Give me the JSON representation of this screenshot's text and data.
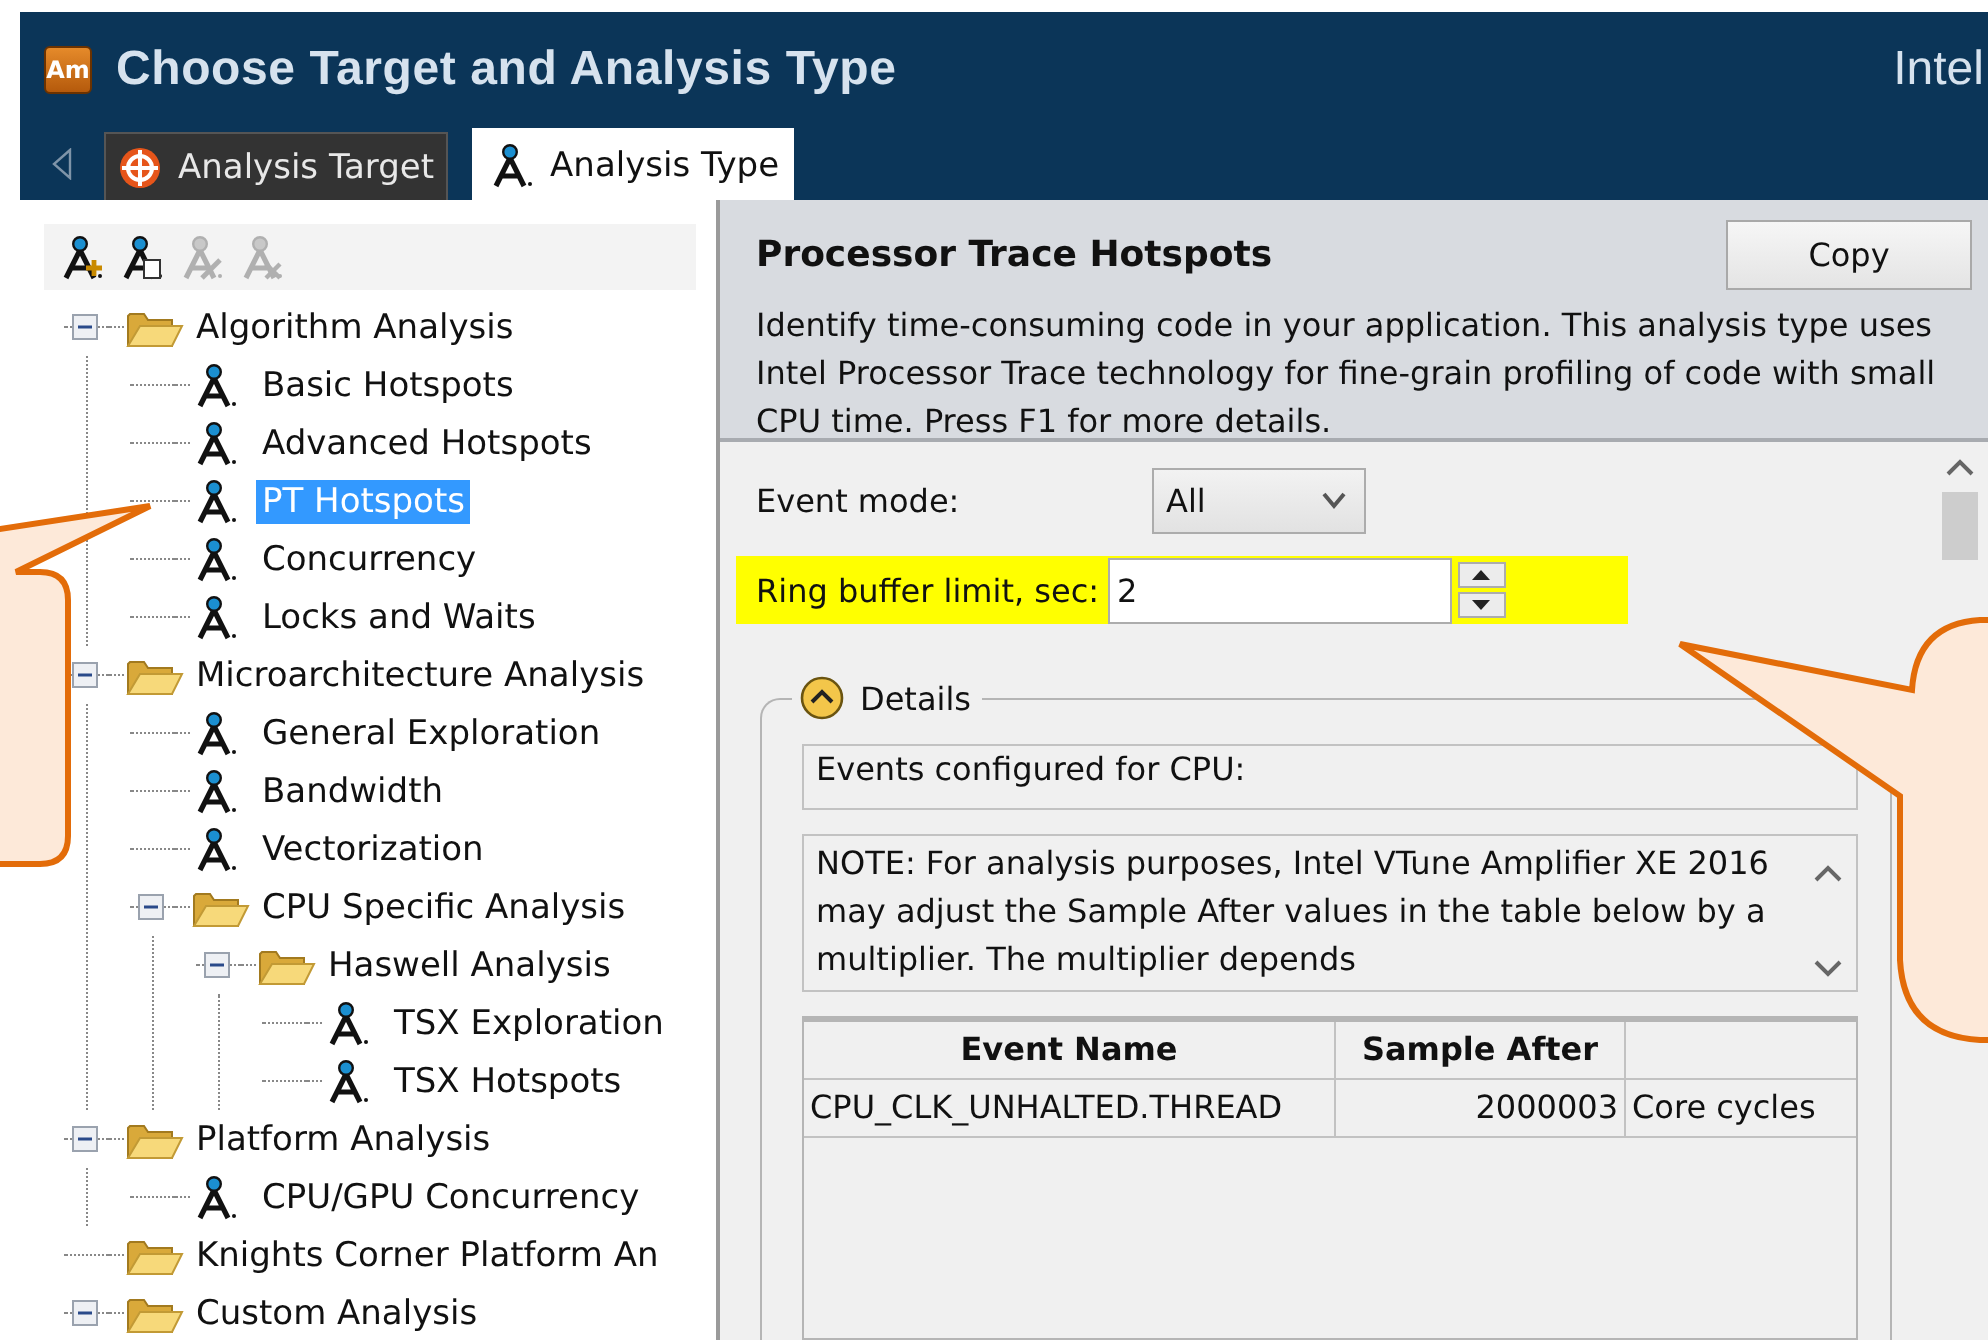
{
  "window": {
    "logo_text": "Am",
    "title": "Choose Target and Analysis Type",
    "brand": "Intel"
  },
  "tabs": [
    {
      "label": "Analysis Target",
      "kind": "target",
      "selected": false
    },
    {
      "label": "Analysis Type",
      "kind": "analysis",
      "selected": true
    }
  ],
  "toolbar": [
    {
      "kind": "add",
      "disabled": false
    },
    {
      "kind": "copy",
      "disabled": false
    },
    {
      "kind": "edit",
      "disabled": true
    },
    {
      "kind": "delete",
      "disabled": true
    }
  ],
  "tree": [
    {
      "label": "Algorithm Analysis",
      "kind": "folder",
      "expanded": true,
      "selected": false,
      "children": [
        {
          "label": "Basic Hotspots",
          "kind": "analysis",
          "selected": false
        },
        {
          "label": "Advanced Hotspots",
          "kind": "analysis",
          "selected": false
        },
        {
          "label": "PT Hotspots",
          "kind": "analysis",
          "selected": true
        },
        {
          "label": "Concurrency",
          "kind": "analysis",
          "selected": false
        },
        {
          "label": "Locks and Waits",
          "kind": "analysis",
          "selected": false
        }
      ]
    },
    {
      "label": "Microarchitecture Analysis",
      "kind": "folder",
      "expanded": true,
      "selected": false,
      "children": [
        {
          "label": "General Exploration",
          "kind": "analysis",
          "selected": false
        },
        {
          "label": "Bandwidth",
          "kind": "analysis",
          "selected": false
        },
        {
          "label": "Vectorization",
          "kind": "analysis",
          "selected": false
        },
        {
          "label": "CPU Specific Analysis",
          "kind": "folder",
          "expanded": true,
          "selected": false,
          "children": [
            {
              "label": "Haswell Analysis",
              "kind": "folder",
              "expanded": true,
              "selected": false,
              "children": [
                {
                  "label": "TSX Exploration",
                  "kind": "analysis",
                  "selected": false
                },
                {
                  "label": "TSX Hotspots",
                  "kind": "analysis",
                  "selected": false
                }
              ]
            }
          ]
        }
      ]
    },
    {
      "label": "Platform Analysis",
      "kind": "folder",
      "expanded": true,
      "selected": false,
      "children": [
        {
          "label": "CPU/GPU Concurrency",
          "kind": "analysis",
          "selected": false
        }
      ]
    },
    {
      "label": "Knights Corner Platform An",
      "kind": "folder",
      "selected": false
    },
    {
      "label": "Custom Analysis",
      "kind": "folder",
      "expanded": true,
      "selected": false
    }
  ],
  "analysis": {
    "title": "Processor Trace Hotspots",
    "copy_button": "Copy",
    "description": "Identify time-consuming code in your application. This analysis type uses Intel Processor Trace technology for fine-grain profiling of code with small CPU time. Press F1 for more details."
  },
  "settings": [
    {
      "kind": "select",
      "label": "Event mode:",
      "value": "All",
      "highlighted": false
    },
    {
      "kind": "spin",
      "label": "Ring buffer limit, sec:",
      "value": "2",
      "highlighted": true
    }
  ],
  "details": {
    "label": "Details",
    "expanded": true,
    "events_heading": "Events configured for CPU:",
    "note": "NOTE: For analysis purposes, Intel VTune Amplifier XE 2016 may adjust the Sample After values in the table below by a multiplier. The multiplier depends",
    "table": {
      "columns": [
        "Event Name",
        "Sample After"
      ],
      "rows": [
        {
          "event_name": "CPU_CLK_UNHALTED.THREAD",
          "sample_after": "2000003",
          "column_3": "Core cycles"
        }
      ]
    }
  }
}
